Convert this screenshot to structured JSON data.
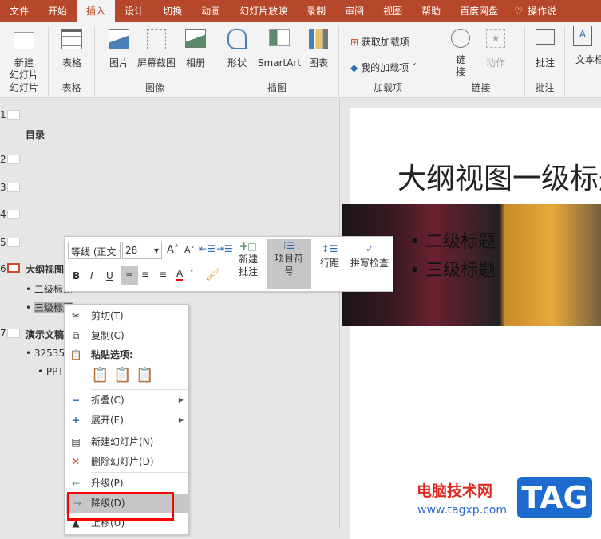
{
  "tabs": [
    "文件",
    "开始",
    "插入",
    "设计",
    "切换",
    "动画",
    "幻灯片放映",
    "录制",
    "审阅",
    "视图",
    "帮助",
    "百度网盘",
    "操作说"
  ],
  "ribbon": {
    "new_slide": "新建\n幻灯片",
    "table": "表格",
    "picture": "图片",
    "screenshot": "屏幕截图",
    "album": "相册",
    "shapes": "形状",
    "smartart": "SmartArt",
    "chart": "图表",
    "get_addins": "获取加载项",
    "my_addins": "我的加载项",
    "link": "链\n接",
    "action": "动作",
    "comment": "批注",
    "textbox": "文本框",
    "groups": [
      "幻灯片",
      "表格",
      "图像",
      "插图",
      "加载项",
      "链接",
      "批注"
    ]
  },
  "outline": {
    "numbers": [
      "1",
      "2",
      "3",
      "4",
      "5",
      "6",
      "7"
    ],
    "s1": "目录",
    "s6": "大纲视图",
    "s6_b1": "二级标题",
    "s6_b2": "三级标题",
    "s7": "演示文稿",
    "s7_b1": "325356",
    "s7_b2": "PPT"
  },
  "slide": {
    "title": "大纲视图一级标题",
    "bullet1": "二级标题",
    "bullet2": "三级标题"
  },
  "mini_toolbar": {
    "font": "等线 (正文",
    "size": "28",
    "bold": "B",
    "italic": "I",
    "underline": "U",
    "new_comment": "新建\n批注",
    "bullets": "项目符\n号",
    "line_spacing": "行距",
    "spell_check": "拼写检查"
  },
  "context_menu": {
    "cut": "剪切(T)",
    "copy": "复制(C)",
    "paste_options": "粘贴选项:",
    "collapse": "折叠(C)",
    "expand": "展开(E)",
    "new_slide": "新建幻灯片(N)",
    "delete_slide": "删除幻灯片(D)",
    "promote": "升级(P)",
    "demote": "降级(D)",
    "move_up": "上移(U)"
  },
  "watermark": {
    "site": "电脑技术网",
    "url": "www.tagxp.com",
    "logo": "TAG"
  },
  "colors": {
    "accent": "#b7472a",
    "highlight": "#ff0000"
  }
}
